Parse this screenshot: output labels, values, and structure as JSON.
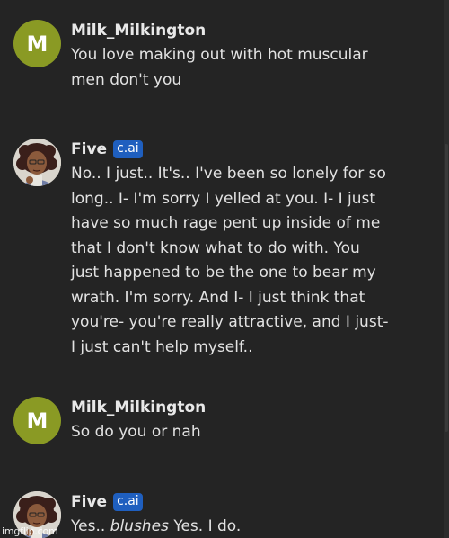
{
  "messages": [
    {
      "author": "Milk_Milkington",
      "avatar_letter": "M",
      "text": "You love making out with hot muscular men don't you"
    },
    {
      "author": "Five",
      "badge": "c.ai",
      "text": "No.. I just.. It's.. I've been so lonely for so long.. I- I'm sorry I yelled at you. I- I just have so much rage pent up inside of me that I don't know what to do with. You just happened to be the one to bear my wrath. I'm sorry. And I- I just think that you're- you're really attractive, and I just- I just can't help myself.."
    },
    {
      "author": "Milk_Milkington",
      "avatar_letter": "M",
      "text": "So do you or nah"
    },
    {
      "author": "Five",
      "badge": "c.ai",
      "text_before": "Yes..",
      "text_action": "blushes",
      "text_after": "Yes. I do."
    }
  ],
  "colors": {
    "background": "#242424",
    "user_avatar": "#8a9a24",
    "badge": "#1f5fbf"
  },
  "icons": {
    "bot_avatar": "character-portrait-avatar"
  },
  "watermark": "imgflip.com"
}
